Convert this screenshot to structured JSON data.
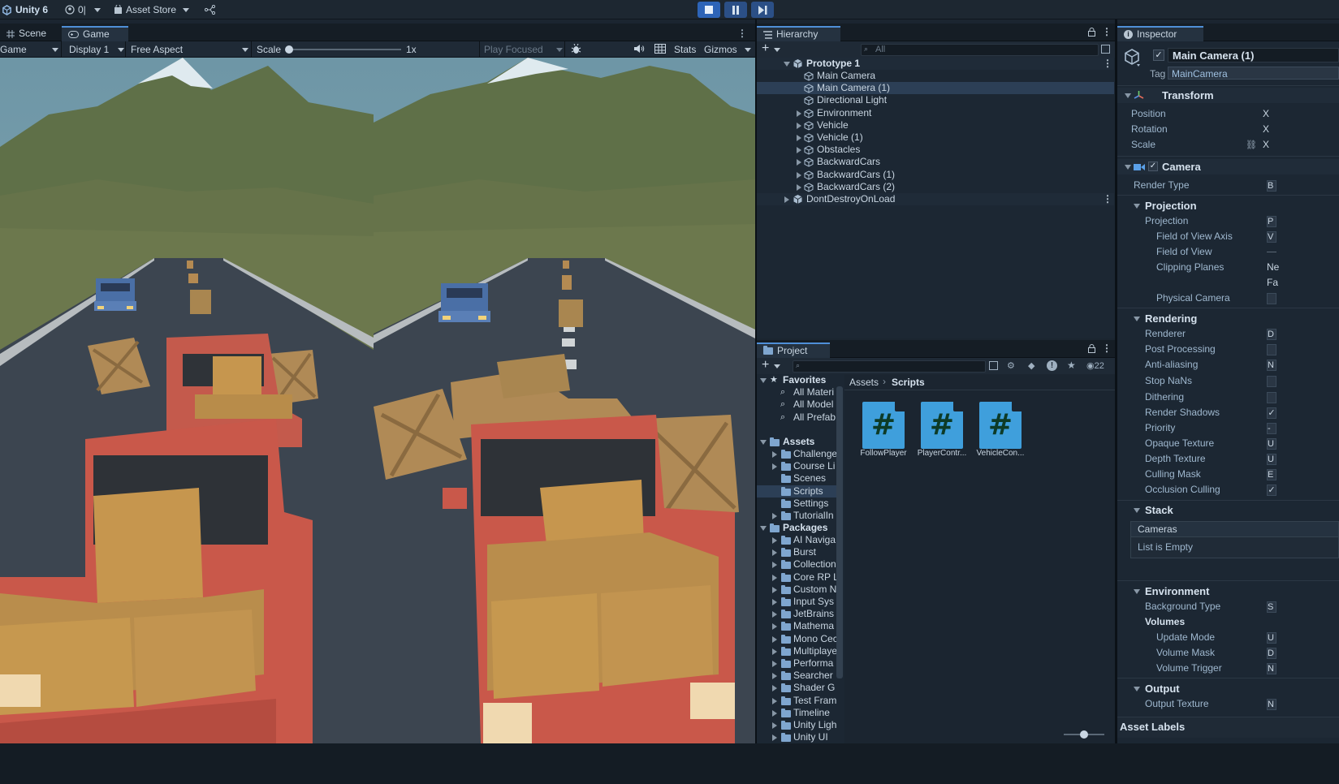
{
  "topbar": {
    "unity_label": "Unity 6",
    "account_count": "0|",
    "asset_store": "Asset Store",
    "colors": {
      "accent": "#2d64b8"
    }
  },
  "game": {
    "tabs": [
      {
        "label": "Scene"
      },
      {
        "label": "Game"
      }
    ],
    "toolbar": {
      "mode": "Game",
      "display": "Display 1",
      "aspect": "Free Aspect",
      "scale_label": "Scale",
      "scale_value": "1x",
      "play_focused": "Play Focused",
      "stats": "Stats",
      "gizmos": "Gizmos"
    }
  },
  "hierarchy": {
    "title": "Hierarchy",
    "search_placeholder": "All",
    "scene_root": "Prototype 1",
    "items": [
      {
        "label": "Main Camera",
        "expandable": false,
        "selected": false
      },
      {
        "label": "Main Camera (1)",
        "expandable": false,
        "selected": true
      },
      {
        "label": "Directional Light",
        "expandable": false,
        "selected": false
      },
      {
        "label": "Environment",
        "expandable": true,
        "selected": false
      },
      {
        "label": "Vehicle",
        "expandable": true,
        "selected": false
      },
      {
        "label": "Vehicle (1)",
        "expandable": true,
        "selected": false
      },
      {
        "label": "Obstacles",
        "expandable": true,
        "selected": false
      },
      {
        "label": "BackwardCars",
        "expandable": true,
        "selected": false
      },
      {
        "label": "BackwardCars (1)",
        "expandable": true,
        "selected": false
      },
      {
        "label": "BackwardCars (2)",
        "expandable": true,
        "selected": false
      }
    ],
    "dont_destroy": "DontDestroyOnLoad"
  },
  "project": {
    "title": "Project",
    "hidden_count": "22",
    "breadcrumb": [
      "Assets",
      "Scripts"
    ],
    "favorites_label": "Favorites",
    "favorites": [
      "All Materi",
      "All Model",
      "All Prefab"
    ],
    "assets_label": "Assets",
    "assets_folders": [
      {
        "label": "Challenge",
        "expandable": true,
        "selected": false
      },
      {
        "label": "Course Li",
        "expandable": true,
        "selected": false
      },
      {
        "label": "Scenes",
        "expandable": false,
        "selected": false
      },
      {
        "label": "Scripts",
        "expandable": false,
        "selected": true
      },
      {
        "label": "Settings",
        "expandable": false,
        "selected": false
      },
      {
        "label": "TutorialIn",
        "expandable": true,
        "selected": false
      }
    ],
    "packages_label": "Packages",
    "packages": [
      "AI Naviga",
      "Burst",
      "Collection",
      "Core RP L",
      "Custom N",
      "Input Sys",
      "JetBrains",
      "Mathema",
      "Mono Cec",
      "Multiplaye",
      "Performa",
      "Searcher",
      "Shader G",
      "Test Fram",
      "Timeline",
      "Unity Ligh",
      "Unity UI"
    ],
    "scripts": [
      {
        "name": "FollowPlayer"
      },
      {
        "name": "PlayerContr..."
      },
      {
        "name": "VehicleCon..."
      }
    ]
  },
  "inspector": {
    "title": "Inspector",
    "object_name": "Main Camera (1)",
    "tag_label": "Tag",
    "tag_value": "MainCamera",
    "transform": {
      "title": "Transform",
      "position": "Position",
      "rotation": "Rotation",
      "scale": "Scale",
      "axis": "X"
    },
    "camera": {
      "title": "Camera",
      "render_type": "Render Type",
      "render_type_value": "B",
      "projection_header": "Projection",
      "projection": "Projection",
      "projection_value": "P",
      "fov_axis": "Field of View Axis",
      "fov_axis_value": "V",
      "fov": "Field of View",
      "clipping": "Clipping Planes",
      "clip_near": "Ne",
      "clip_far": "Fa",
      "physical": "Physical Camera",
      "rendering_header": "Rendering",
      "renderer": "Renderer",
      "renderer_value": "D",
      "post_processing": "Post Processing",
      "anti_aliasing": "Anti-aliasing",
      "anti_aliasing_value": "N",
      "stop_nans": "Stop NaNs",
      "dithering": "Dithering",
      "render_shadows": "Render Shadows",
      "priority": "Priority",
      "priority_value": "-",
      "opaque_texture": "Opaque Texture",
      "opaque_texture_value": "U",
      "depth_texture": "Depth Texture",
      "depth_texture_value": "U",
      "culling_mask": "Culling Mask",
      "culling_mask_value": "E",
      "occlusion_culling": "Occlusion Culling",
      "stack_header": "Stack",
      "cameras": "Cameras",
      "list_empty": "List is Empty",
      "environment_header": "Environment",
      "background_type": "Background Type",
      "background_type_value": "S",
      "volumes_header": "Volumes",
      "update_mode": "Update Mode",
      "update_mode_value": "U",
      "volume_mask": "Volume Mask",
      "volume_mask_value": "D",
      "volume_trigger": "Volume Trigger",
      "volume_trigger_value": "N",
      "output_header": "Output",
      "output_texture": "Output Texture",
      "output_texture_value": "N"
    },
    "asset_labels": "Asset Labels"
  }
}
